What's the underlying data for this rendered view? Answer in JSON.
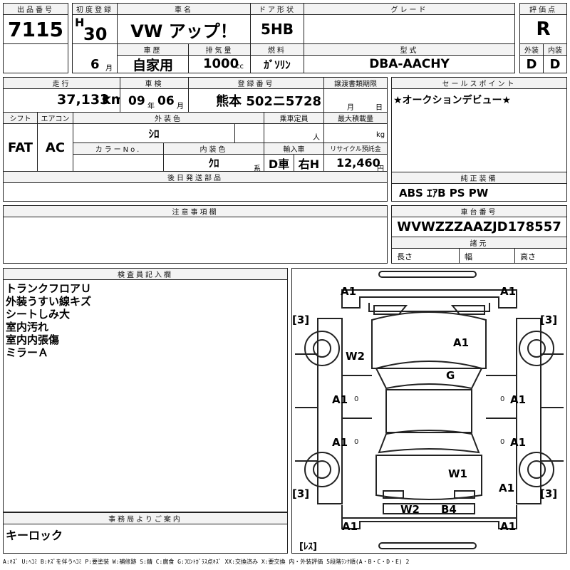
{
  "hdr": {
    "lot_no": "出品番号",
    "first_reg": "初度登録",
    "car_name": "車名",
    "door": "ドア形状",
    "grade": "グレード",
    "score": "評価点",
    "history": "車歴",
    "displacement": "排気量",
    "fuel": "燃料",
    "model_code": "型式",
    "exterior": "外装",
    "interior": "内装",
    "mileage": "走行",
    "inspection": "車検",
    "reg_no": "登録番号",
    "transfer_deadline": "譲渡書類期限",
    "sales_point": "セールスポイント",
    "shift": "シフト",
    "aircon": "エアコン",
    "ext_color": "外装色",
    "capacity": "乗車定員",
    "max_load": "最大積載量",
    "color_no": "カラーNo.",
    "int_color": "内装色",
    "import": "輸入車",
    "recycle": "リサイクル預託金",
    "later_parts": "後日発送部品",
    "genuine_equip": "純正装備",
    "notes": "注意事項欄",
    "chassis_no": "車台番号",
    "specs": "諸元",
    "inspector": "検査員記入欄",
    "office": "事務局よりご案内"
  },
  "values": {
    "lot_no": "7115",
    "era": "H",
    "year": "30",
    "year_unit": "年",
    "month": "6",
    "month_unit": "月",
    "car_name": "VW アップ！",
    "door": "5HB",
    "grade": "",
    "score": "R",
    "history": "自家用",
    "displacement": "1000",
    "displacement_unit": "cc",
    "fuel": "ｶﾞｿﾘﾝ",
    "model_code": "DBA-AACHY",
    "exterior": "D",
    "interior": "D",
    "mileage": "37,133",
    "mileage_unit": "km",
    "insp_year": "09",
    "insp_year_unit": "年",
    "insp_month": "06",
    "insp_month_unit": "月",
    "reg_no": "熊本 502ニ5728",
    "transfer_month_unit": "月",
    "transfer_day_unit": "日",
    "sales_point": "★オークションデビュー★",
    "shift": "FAT",
    "aircon": "AC",
    "ext_color": "ｼﾛ",
    "capacity_unit": "人",
    "max_load_unit": "kg",
    "int_color": "ｸﾛ",
    "int_color_unit": "系",
    "import": "D車",
    "steering": "右H",
    "recycle": "12,460",
    "recycle_unit": "円",
    "genuine_equip": "ABS ｴｱB PS PW",
    "chassis_no": "WVWZZZAAZJD178557",
    "spec_length": "長さ",
    "spec_width": "幅",
    "spec_height": "高さ",
    "inspector_notes": [
      "トランクフロアＵ",
      "外装うすい線キズ",
      "シートしみ大",
      "室内汚れ",
      "室内内張傷",
      "ミラーＡ"
    ],
    "office_note": "キーロック"
  },
  "diagram": {
    "marks": {
      "fl_top": "A1",
      "fr_top": "A1",
      "bonnet": "A1",
      "windshield": "G",
      "fender_left": "W2",
      "door_fl": "A1",
      "door_fr": "A1",
      "door_rl": "A1",
      "door_rr": "A1",
      "roof_rear": "W1",
      "qtr_r": "A1",
      "rear_l": "W2",
      "rear_r": "B4",
      "rl_bot": "A1",
      "rr_bot": "A1",
      "tire_fl": "3",
      "tire_fr": "3",
      "tire_rl": "3",
      "tire_rr": "3",
      "spare": "ﾚｽ",
      "zero_fl": "0",
      "zero_fr": "0",
      "zero_rl": "0",
      "zero_rr": "0"
    }
  },
  "legend": "A:ｷｽﾞ U:ﾍｺﾐ B:ｷｽﾞを伴うﾍｺﾐ P:要塗装 W:補修跡 S:錆 C:腐食 G:ﾌﾛﾝﾄｶﾞﾗｽ点ｷｽﾞ XX:交換済み X:要交換 内・外装評価 5段階ﾗﾝｸ順(A・B・C・D・E) 2"
}
